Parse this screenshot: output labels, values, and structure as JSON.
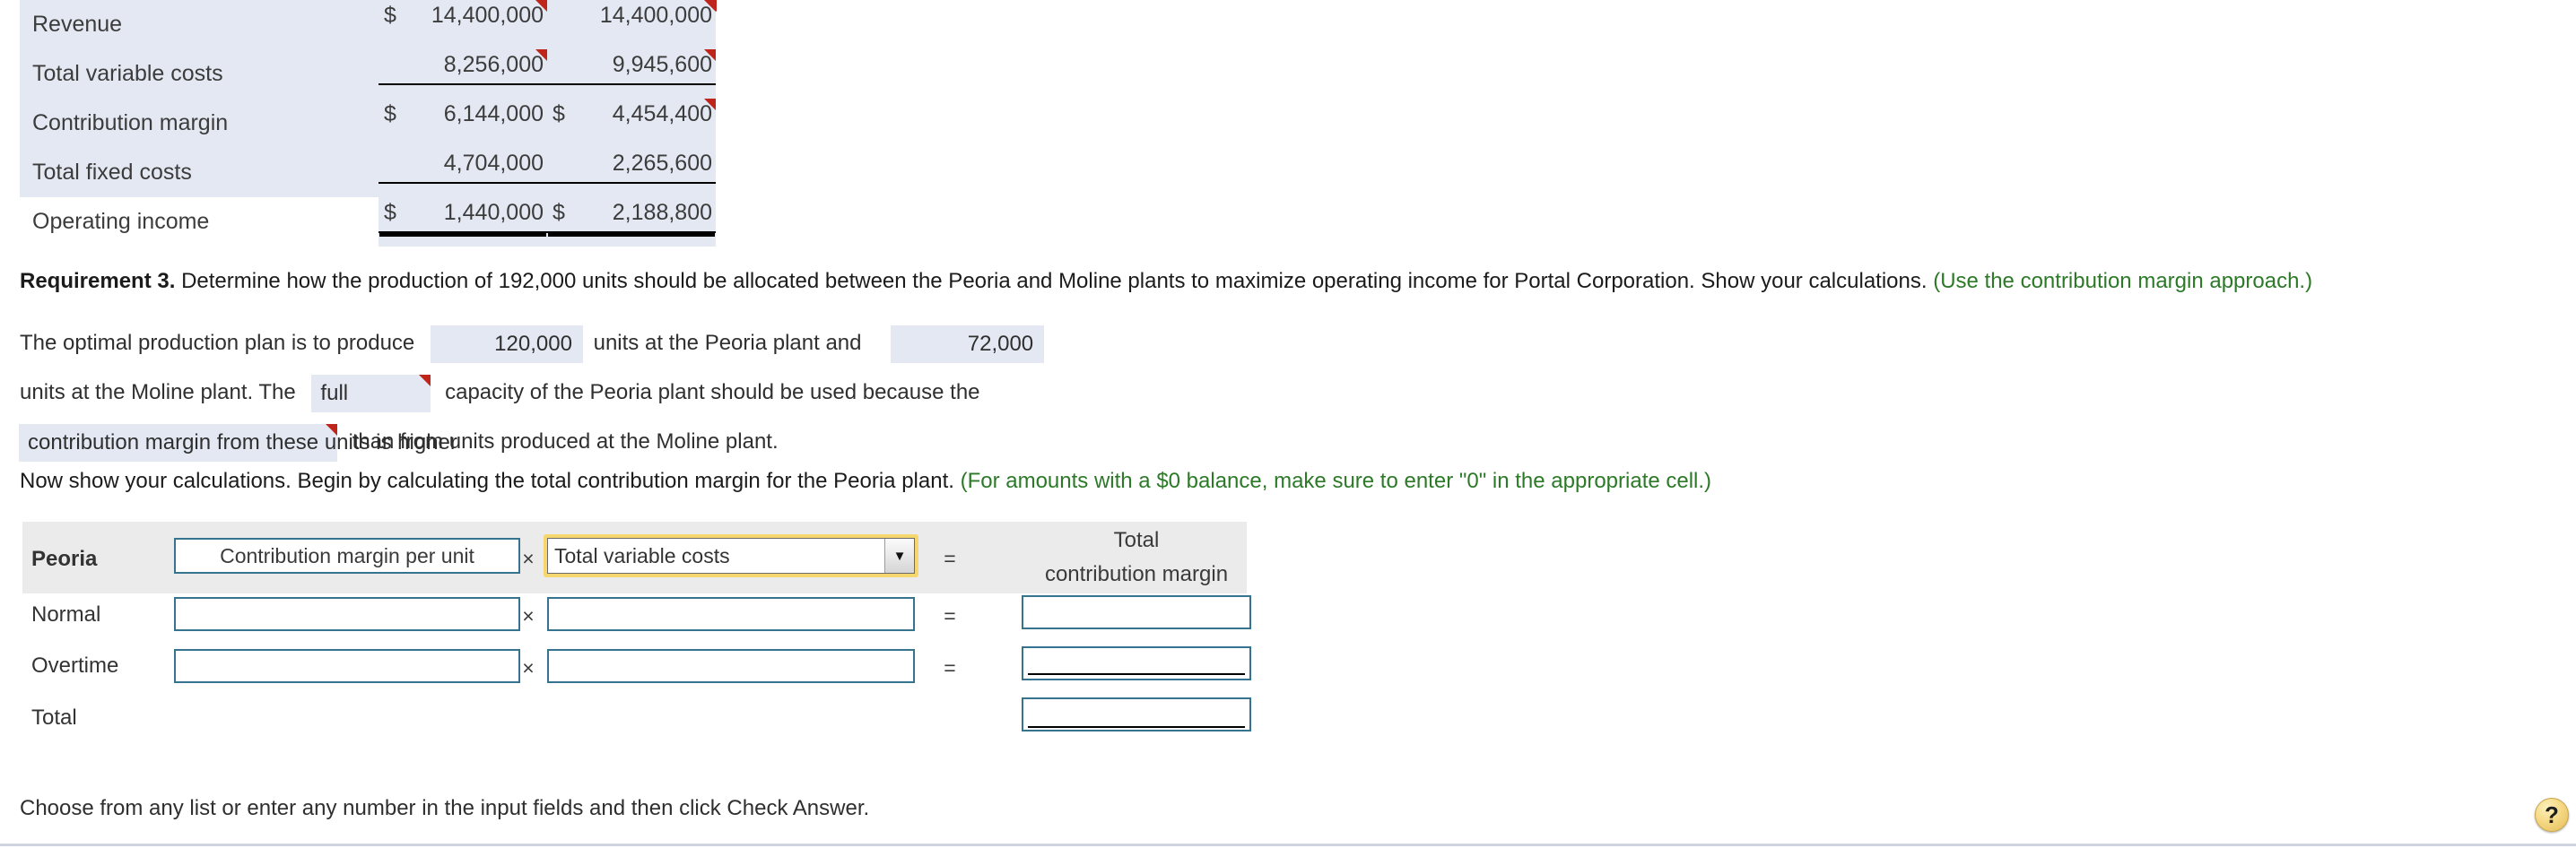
{
  "income_statement": {
    "rows": [
      {
        "label": "Revenue",
        "col1_currency": "$",
        "col1_value": "14,400,000",
        "col2_currency": "",
        "col2_value": "14,400,000",
        "rule": "none",
        "flag_col1": true,
        "flag_col2": true,
        "flag_label": true,
        "shaded_label": true
      },
      {
        "label": "Total variable costs",
        "col1_currency": "",
        "col1_value": "8,256,000",
        "col2_currency": "",
        "col2_value": "9,945,600",
        "rule": "single",
        "flag_col1": true,
        "flag_col2": true,
        "flag_label": true,
        "shaded_label": true
      },
      {
        "label": "Contribution margin",
        "col1_currency": "$",
        "col1_value": "6,144,000",
        "col2_currency": "$",
        "col2_value": "4,454,400",
        "rule": "none",
        "flag_col1": false,
        "flag_col2": true,
        "flag_label": false,
        "shaded_label": true
      },
      {
        "label": "Total fixed costs",
        "col1_currency": "",
        "col1_value": "4,704,000",
        "col2_currency": "",
        "col2_value": "2,265,600",
        "rule": "single",
        "flag_col1": false,
        "flag_col2": false,
        "flag_label": false,
        "shaded_label": true
      },
      {
        "label": "Operating income",
        "col1_currency": "$",
        "col1_value": "1,440,000",
        "col2_currency": "$",
        "col2_value": "2,188,800",
        "rule": "double",
        "flag_col1": false,
        "flag_col2": false,
        "flag_label": false,
        "shaded_label": false
      }
    ]
  },
  "requirement3": {
    "heading": "Requirement 3.",
    "prompt": "Determine how the production of 192,000 units should be allocated between the Peoria and Moline plants to maximize operating income for Portal Corporation. Show your calculations.",
    "hint": "(Use the contribution margin approach.)"
  },
  "fill_in": {
    "seg1": "The optimal production plan is to produce",
    "blank_peoria_units": "120,000",
    "seg2": "units at the Peoria plant and",
    "blank_moline_units": "72,000",
    "seg3": "units at the Moline plant. The",
    "blank_capacity": "full",
    "seg4": "capacity of the Peoria plant should be used because the",
    "blank_reason": "contribution margin from these units is higher",
    "seg5": "than from units produced at the Moline plant."
  },
  "calc_intro": {
    "text": "Now show your calculations. Begin by calculating the total contribution margin for the Peoria plant.",
    "hint": "(For amounts with a $0 balance, make sure to enter \"0\" in the appropriate cell.)"
  },
  "answer_form": {
    "header": {
      "row_label": "Peoria",
      "factor1_label": "Contribution margin per unit",
      "multiply_symbol": "×",
      "select_value": "Total variable costs",
      "select_arrow_glyph": "▼",
      "equals_symbol": "=",
      "total_label_line1": "Total",
      "total_label_line2": "contribution margin"
    },
    "rows": [
      {
        "label": "Normal",
        "factor1": "",
        "factor2": "",
        "total": "",
        "multiply_symbol": "×",
        "equals_symbol": "=",
        "total_rule": "none"
      },
      {
        "label": "Overtime",
        "factor1": "",
        "factor2": "",
        "total": "",
        "multiply_symbol": "×",
        "equals_symbol": "=",
        "total_rule": "single"
      },
      {
        "label": "Total",
        "factor1": null,
        "factor2": null,
        "total": "",
        "multiply_symbol": "",
        "equals_symbol": "",
        "total_rule": "double"
      }
    ]
  },
  "footer": {
    "note": "Choose from any list or enter any number in the input fields and then click Check Answer.",
    "help_glyph": "?"
  },
  "colors": {
    "shaded_cell": "#e3e8f2",
    "form_header_band": "#ebebeb",
    "input_border": "#35738f",
    "focus_glow": "#f5d76e",
    "hint_green": "#2c7a28",
    "comment_flag_red": "#c0251c"
  }
}
